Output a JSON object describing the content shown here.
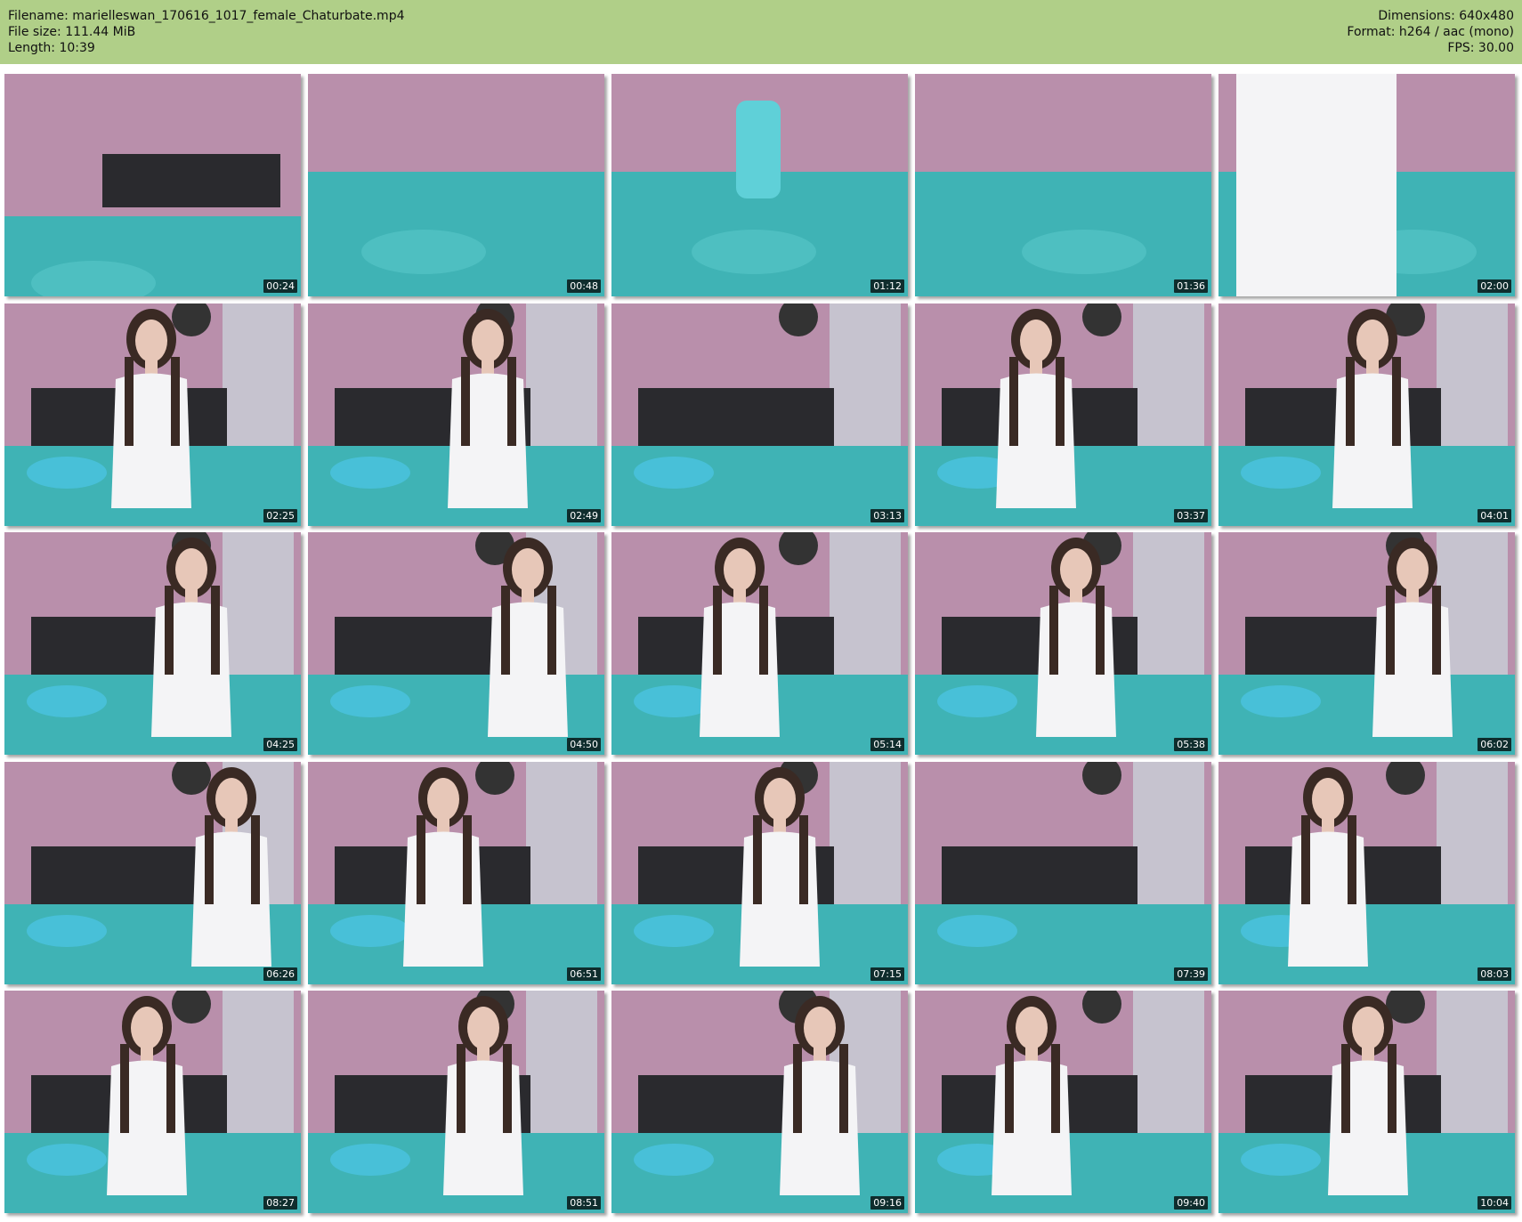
{
  "header": {
    "filename": "Filename: marielleswan_170616_1017_female_Chaturbate.mp4",
    "filesize": "File size: 111.44 MiB",
    "length": "Length: 10:39",
    "dimensions": "Dimensions: 640x480",
    "format": "Format: h264 / aac (mono)",
    "fps": "FPS: 30.00"
  },
  "colors": {
    "header_bg": "#b0cf88",
    "wall": "#b98fab",
    "bed": "#3fb3b5",
    "headboard": "#2a2a2e",
    "shirt": "#f4f4f6"
  },
  "thumbnails": [
    {
      "time": "00:24"
    },
    {
      "time": "00:48"
    },
    {
      "time": "01:12"
    },
    {
      "time": "01:36"
    },
    {
      "time": "02:00"
    },
    {
      "time": "02:25"
    },
    {
      "time": "02:49"
    },
    {
      "time": "03:13"
    },
    {
      "time": "03:37"
    },
    {
      "time": "04:01"
    },
    {
      "time": "04:25"
    },
    {
      "time": "04:50"
    },
    {
      "time": "05:14"
    },
    {
      "time": "05:38"
    },
    {
      "time": "06:02"
    },
    {
      "time": "06:26"
    },
    {
      "time": "06:51"
    },
    {
      "time": "07:15"
    },
    {
      "time": "07:39"
    },
    {
      "time": "08:03"
    },
    {
      "time": "08:27"
    },
    {
      "time": "08:51"
    },
    {
      "time": "09:16"
    },
    {
      "time": "09:40"
    },
    {
      "time": "10:04"
    }
  ]
}
